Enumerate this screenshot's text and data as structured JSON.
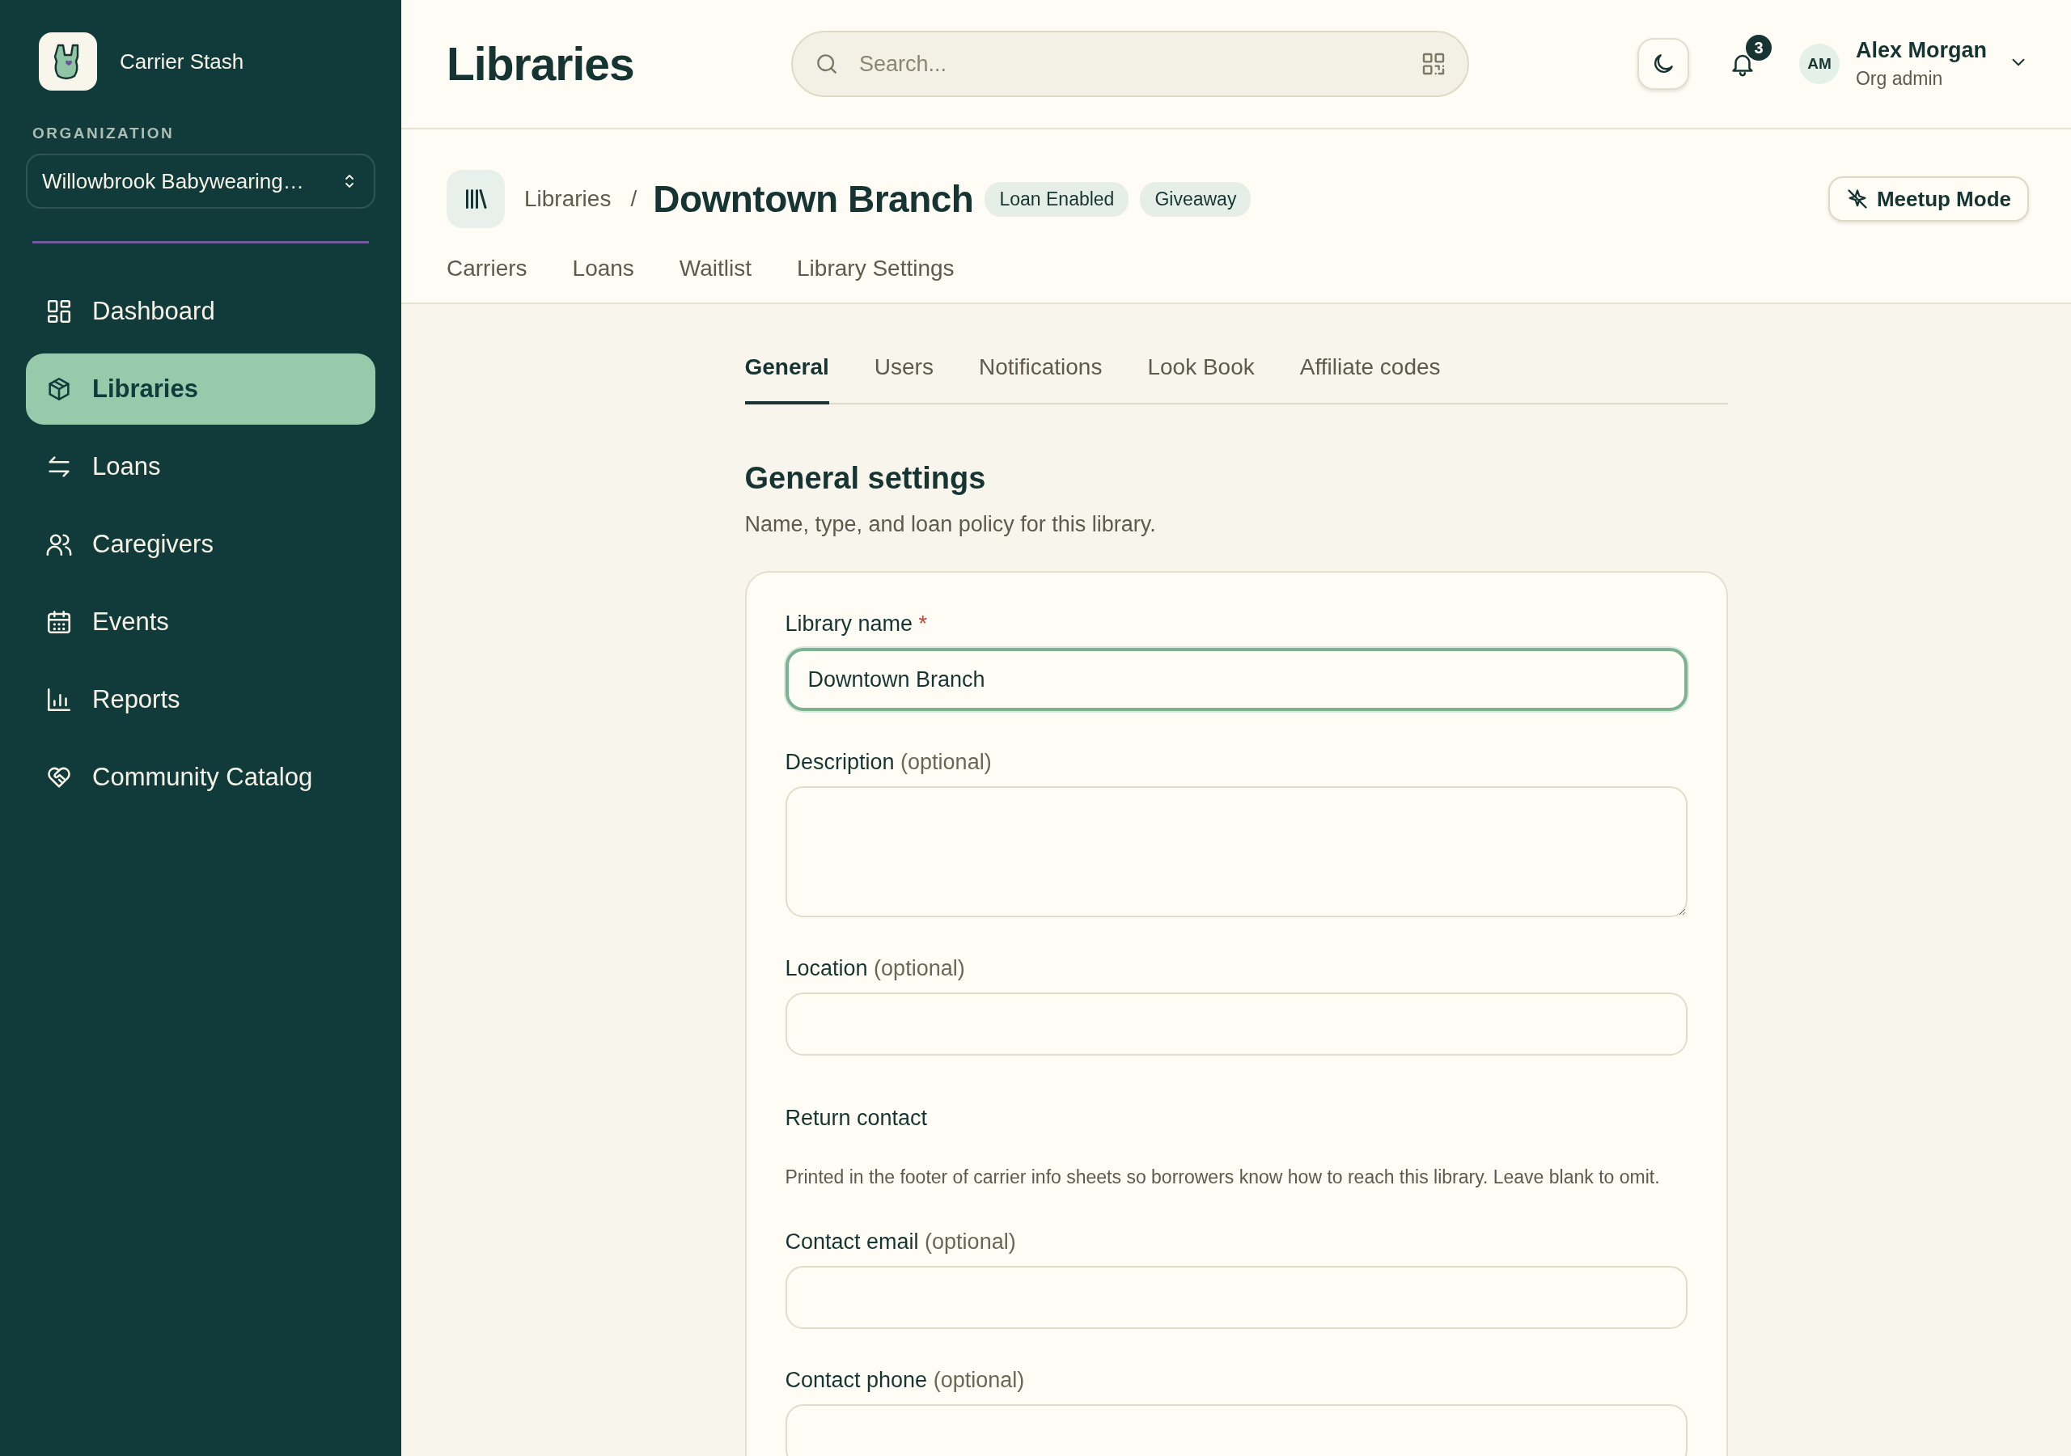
{
  "app": {
    "name": "Carrier Stash"
  },
  "organization": {
    "label": "ORGANIZATION",
    "value": "Willowbrook Babywearing…"
  },
  "sidebar": {
    "items": [
      {
        "label": "Dashboard",
        "selected": false
      },
      {
        "label": "Libraries",
        "selected": true
      },
      {
        "label": "Loans",
        "selected": false
      },
      {
        "label": "Caregivers",
        "selected": false
      },
      {
        "label": "Events",
        "selected": false
      },
      {
        "label": "Reports",
        "selected": false
      },
      {
        "label": "Community Catalog",
        "selected": false
      }
    ]
  },
  "header": {
    "title": "Libraries",
    "search": {
      "placeholder": "Search..."
    },
    "notifications": {
      "count": "3"
    },
    "user": {
      "initials": "AM",
      "name": "Alex Morgan",
      "role": "Org admin"
    }
  },
  "library": {
    "breadcrumb": "Libraries",
    "separator": "/",
    "name": "Downtown Branch",
    "badges": [
      "Loan Enabled",
      "Giveaway"
    ],
    "action": "Meetup Mode",
    "tabs": [
      {
        "label": "Carriers",
        "selected": false
      },
      {
        "label": "Loans",
        "selected": false
      },
      {
        "label": "Waitlist",
        "selected": false
      },
      {
        "label": "Library Settings",
        "selected": false
      }
    ]
  },
  "settings": {
    "tabs": [
      {
        "label": "General",
        "selected": true
      },
      {
        "label": "Users",
        "selected": false
      },
      {
        "label": "Notifications",
        "selected": false
      },
      {
        "label": "Look Book",
        "selected": false
      },
      {
        "label": "Affiliate codes",
        "selected": false
      }
    ],
    "title": "General settings",
    "subtitle": "Name, type, and loan policy for this library.",
    "fields": [
      {
        "kind": "input",
        "label": "Library name",
        "required_mark": "*",
        "value": "Downtown Branch",
        "focused": true
      },
      {
        "kind": "textarea",
        "label": "Description",
        "hint": "(optional)"
      },
      {
        "kind": "input",
        "label": "Location",
        "hint": "(optional)",
        "focused": false
      },
      {
        "kind": "heading",
        "text": "Return contact"
      },
      {
        "kind": "note",
        "text": "Printed in the footer of carrier info sheets so borrowers know how to reach this library. Leave blank to omit."
      },
      {
        "kind": "input",
        "label": "Contact email",
        "hint": "(optional)",
        "focused": false
      },
      {
        "kind": "input",
        "label": "Contact phone",
        "hint": "(optional)",
        "focused": false
      }
    ]
  }
}
